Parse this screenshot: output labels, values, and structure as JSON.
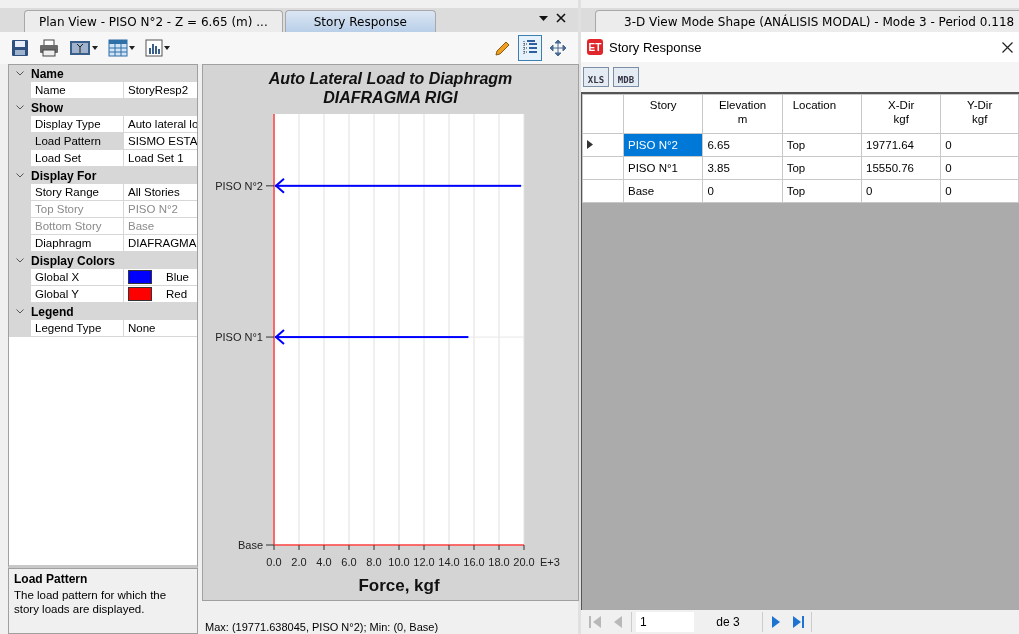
{
  "left_pane": {
    "tabs": [
      {
        "label": "Plan View - PISO N°2 - Z = 6.65 (m)  ...",
        "selected": false
      },
      {
        "label": "Story Response",
        "selected": true
      }
    ],
    "toolbar_left": [
      {
        "kind": "save",
        "dropdown": false
      },
      {
        "kind": "print",
        "dropdown": false
      },
      {
        "kind": "picture",
        "dropdown": true
      },
      {
        "kind": "table",
        "dropdown": true
      },
      {
        "kind": "chart",
        "dropdown": true
      }
    ],
    "toolbar_right": [
      {
        "kind": "pencil",
        "pressed": false
      },
      {
        "kind": "tree",
        "pressed": true
      },
      {
        "kind": "move",
        "pressed": false
      }
    ],
    "properties": [
      {
        "category": "Name",
        "items": [
          {
            "name": "Name",
            "value": "StoryResp2",
            "kind": "text",
            "selected": false,
            "disabled": false
          }
        ]
      },
      {
        "category": "Show",
        "items": [
          {
            "name": "Display Type",
            "value": "Auto lateral lo",
            "kind": "text",
            "selected": false,
            "disabled": false
          },
          {
            "name": "Load Pattern",
            "value": "SISMO ESTA",
            "kind": "text",
            "selected": true,
            "disabled": false
          },
          {
            "name": "Load Set",
            "value": "Load Set 1",
            "kind": "text",
            "selected": false,
            "disabled": false
          }
        ]
      },
      {
        "category": "Display For",
        "items": [
          {
            "name": "Story Range",
            "value": "All Stories",
            "kind": "text",
            "selected": false,
            "disabled": false
          },
          {
            "name": "Top Story",
            "value": "PISO N°2",
            "kind": "text",
            "selected": false,
            "disabled": true
          },
          {
            "name": "Bottom Story",
            "value": "Base",
            "kind": "text",
            "selected": false,
            "disabled": true
          },
          {
            "name": "Diaphragm",
            "value": "DIAFRAGMA",
            "kind": "text",
            "selected": false,
            "disabled": false
          }
        ]
      },
      {
        "category": "Display Colors",
        "items": [
          {
            "name": "Global X",
            "value": "Blue",
            "kind": "color",
            "color": "#0000ff",
            "selected": false,
            "disabled": false
          },
          {
            "name": "Global Y",
            "value": "Red",
            "kind": "color",
            "color": "#ff0000",
            "selected": false,
            "disabled": false
          }
        ]
      },
      {
        "category": "Legend",
        "items": [
          {
            "name": "Legend Type",
            "value": "None",
            "kind": "text",
            "selected": false,
            "disabled": false
          }
        ]
      }
    ],
    "description": {
      "title": "Load Pattern",
      "text": "The load pattern for which the story loads are displayed."
    },
    "chart": {
      "x_scale_label": "E+3",
      "chart_data": {
        "type": "bar",
        "orientation": "horizontal",
        "title": "Auto Lateral Load to Diaphragm DIAFRAGMA RIGI",
        "xlabel": "Force, kgf",
        "grid": true,
        "categories": [
          "PISO N°2",
          "PISO N°1",
          "Base"
        ],
        "series": [
          {
            "color": "#0000ff",
            "values": [
              19.77,
              15.55,
              0
            ]
          }
        ],
        "xlim": [
          0,
          20
        ],
        "xticks": [
          {
            "value": 0,
            "label": "0.0"
          },
          {
            "value": 2,
            "label": "2.0"
          },
          {
            "value": 4,
            "label": "4.0"
          },
          {
            "value": 6,
            "label": "6.0"
          },
          {
            "value": 8,
            "label": "8.0"
          },
          {
            "value": 10,
            "label": "10.0"
          },
          {
            "value": 12,
            "label": "12.0"
          },
          {
            "value": 14,
            "label": "14.0"
          },
          {
            "value": 16,
            "label": "16.0"
          },
          {
            "value": 18,
            "label": "18.0"
          },
          {
            "value": 20,
            "label": "20.0"
          }
        ]
      }
    },
    "status": "Max: (19771.638045, PISO N°2);   Min: (0, Base)"
  },
  "right_pane": {
    "tabs": [
      {
        "label": "3-D View  Mode Shape (ANÁLISIS MODAL) - Mode 3 - Period 0.118",
        "selected": false
      }
    ],
    "window": {
      "badge": "ET",
      "title": "Story Response"
    },
    "export_buttons": [
      "XLS",
      "MDB"
    ],
    "table": {
      "columns": [
        {
          "label": "Story"
        },
        {
          "label": "Elevation",
          "unit": "m"
        },
        {
          "label": "Location"
        },
        {
          "label": "X-Dir",
          "unit": "kgf"
        },
        {
          "label": "Y-Dir",
          "unit": "kgf"
        }
      ],
      "rows": [
        {
          "selected": true,
          "cells": [
            "PISO N°2",
            "6.65",
            "Top",
            "19771.64",
            "0"
          ]
        },
        {
          "selected": false,
          "cells": [
            "PISO N°1",
            "3.85",
            "Top",
            "15550.76",
            "0"
          ]
        },
        {
          "selected": false,
          "cells": [
            "Base",
            "0",
            "Top",
            "0",
            "0"
          ]
        }
      ]
    },
    "navigator": {
      "first_disabled": true,
      "prev_disabled": true,
      "page": "1",
      "of": "de 3",
      "next_disabled": false,
      "last_disabled": false
    }
  }
}
